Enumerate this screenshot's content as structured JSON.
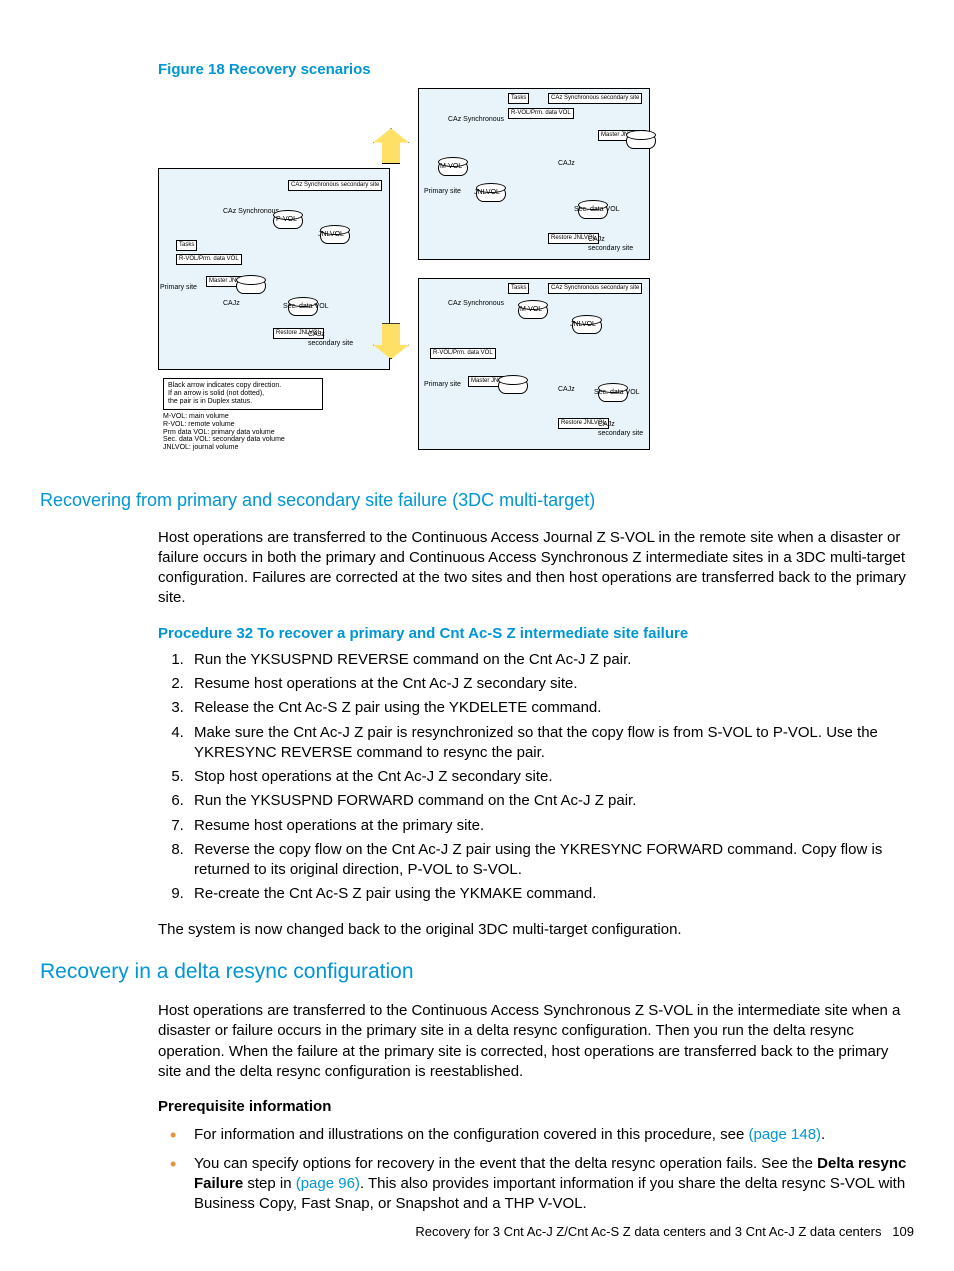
{
  "figure": {
    "caption": "Figure 18 Recovery scenarios",
    "legend_note": "Black arrow indicates copy direction.\nIf an arrow is solid (not dotted),\nthe pair is in Duplex status.",
    "legend_defs": "M-VOL: main volume\nR-VOL: remote volume\nPrm data VOL: primary data volume\nSec. data VOL: secondary data volume\nJNLVOL: journal volume",
    "labels": {
      "caz_sync": "CAz\nSynchronous",
      "cajz": "CAJz",
      "caz_sync_sec": "CAz Synchronous\nsecondary site",
      "sec_site": "secondary site",
      "prim_site": "Primary site",
      "tasks": "Tasks",
      "rvol_prm": "R-VOL/Prm.\ndata VOL",
      "master_jnl": "Master\nJNLVOL",
      "restore_jnl": "Restore\nJNLVOL",
      "pvol": "P-VOL",
      "mvol": "M-VOL",
      "jnlvol": "JNLVOL",
      "sec_data_vol": "Sec. data VOL"
    }
  },
  "section1": {
    "title": "Recovering from primary and secondary site failure (3DC multi-target)",
    "para": "Host operations are transferred to the Continuous Access Journal Z S-VOL in the remote site when a disaster or failure occurs in both the primary and Continuous Access Synchronous Z intermediate sites in a 3DC multi-target configuration. Failures are corrected at the two sites and then host operations are transferred back to the primary site.",
    "procedure_title": "Procedure 32 To recover a primary and Cnt Ac-S Z intermediate site failure",
    "steps": [
      "Run the YKSUSPND REVERSE command on the Cnt Ac-J Z pair.",
      "Resume host operations at the Cnt Ac-J Z secondary site.",
      "Release the Cnt Ac-S Z pair using the YKDELETE command.",
      "Make sure the Cnt Ac-J Z pair is resynchronized so that the copy flow is from S-VOL to P-VOL. Use the YKRESYNC REVERSE command to resync the pair.",
      "Stop host operations at the Cnt Ac-J Z secondary site.",
      "Run the YKSUSPND FORWARD command on the Cnt Ac-J Z pair.",
      "Resume host operations at the primary site.",
      "Reverse the copy flow on the Cnt Ac-J Z pair using the YKRESYNC FORWARD command. Copy flow is returned to its original direction, P-VOL to S-VOL.",
      "Re-create the Cnt Ac-S Z pair using the YKMAKE command."
    ],
    "closing": "The system is now changed back to the original 3DC multi-target configuration."
  },
  "section2": {
    "title": "Recovery in a delta resync configuration",
    "para": "Host operations are transferred to the Continuous Access Synchronous Z S-VOL in the intermediate site when a disaster or failure occurs in the primary site in a delta resync configuration. Then you run the delta resync operation. When the failure at the primary site is corrected, host operations are transferred back to the primary site and the delta resync configuration is reestablished.",
    "prereq_heading": "Prerequisite information",
    "bullet1_pre": "For information and illustrations on the configuration covered in this procedure, see ",
    "bullet1_link": "(page 148)",
    "bullet1_post": ".",
    "bullet2_pre": "You can specify options for recovery in the event that the delta resync operation fails. See the ",
    "bullet2_bold": "Delta resync Failure",
    "bullet2_mid": " step in ",
    "bullet2_link": "(page 96)",
    "bullet2_post": ". This also provides important information if you share the delta resync S-VOL with Business Copy, Fast Snap, or Snapshot and a THP V-VOL."
  },
  "footer": {
    "text": "Recovery for 3 Cnt Ac-J Z/Cnt Ac-S Z data centers and 3 Cnt Ac-J Z data centers",
    "page": "109"
  }
}
